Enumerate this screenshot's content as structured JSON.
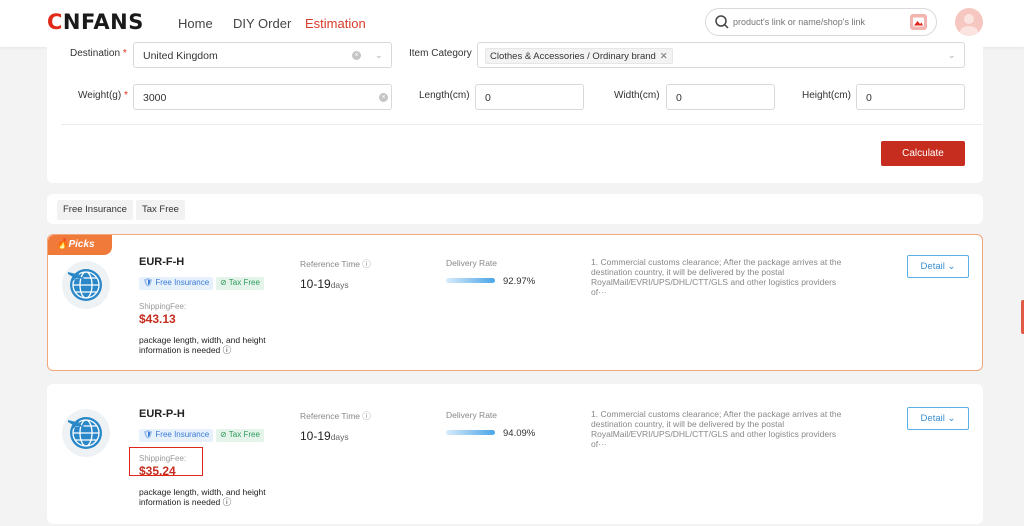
{
  "header": {
    "logo": "CNFANS",
    "nav": [
      {
        "label": "Home",
        "active": false
      },
      {
        "label": "DIY Order",
        "active": false
      },
      {
        "label": "Estimation",
        "active": true
      }
    ],
    "search_placeholder": "product's link or name/shop's link"
  },
  "form": {
    "destination_label": "Destination",
    "destination_value": "United Kingdom",
    "category_label": "Item Category",
    "category_tag": "Clothes & Accessories / Ordinary brand",
    "weight_label": "Weight(g)",
    "weight_value": "3000",
    "length_label": "Length(cm)",
    "length_value": "0",
    "width_label": "Width(cm)",
    "width_value": "0",
    "height_label": "Height(cm)",
    "height_value": "0",
    "calculate_label": "Calculate"
  },
  "filters": [
    "Free Insurance",
    "Tax Free"
  ],
  "results": [
    {
      "badge": "Picks",
      "name": "EUR-F-H",
      "tags": [
        "Free Insurance",
        "Tax Free"
      ],
      "fee_label": "ShippingFee:",
      "fee": "$43.13",
      "note": "package length, width, and height information is needed",
      "ref_label": "Reference Time",
      "ref_value": "10-19",
      "ref_unit": "days",
      "rate_label": "Delivery Rate",
      "rate": "92.97%",
      "desc_lines": [
        "1. Commercial customs clearance; After the package arrives at the",
        "destination country, it will be delivered by the postal",
        "RoyalMail/EVRI/UPS/DHL/CTT/GLS and other logistics providers of···"
      ],
      "detail_label": "Detail"
    },
    {
      "name": "EUR-P-H",
      "tags": [
        "Free Insurance",
        "Tax Free"
      ],
      "fee_label": "ShippingFee:",
      "fee": "$35.24",
      "note": "package length, width, and height information is needed",
      "ref_label": "Reference Time",
      "ref_value": "10-19",
      "ref_unit": "days",
      "rate_label": "Delivery Rate",
      "rate": "94.09%",
      "desc_lines": [
        "1. Commercial customs clearance; After the package arrives at the",
        "destination country, it will be delivered by the postal",
        "RoyalMail/EVRI/UPS/DHL/CTT/GLS and other logistics providers of···"
      ],
      "detail_label": "Detail"
    }
  ]
}
